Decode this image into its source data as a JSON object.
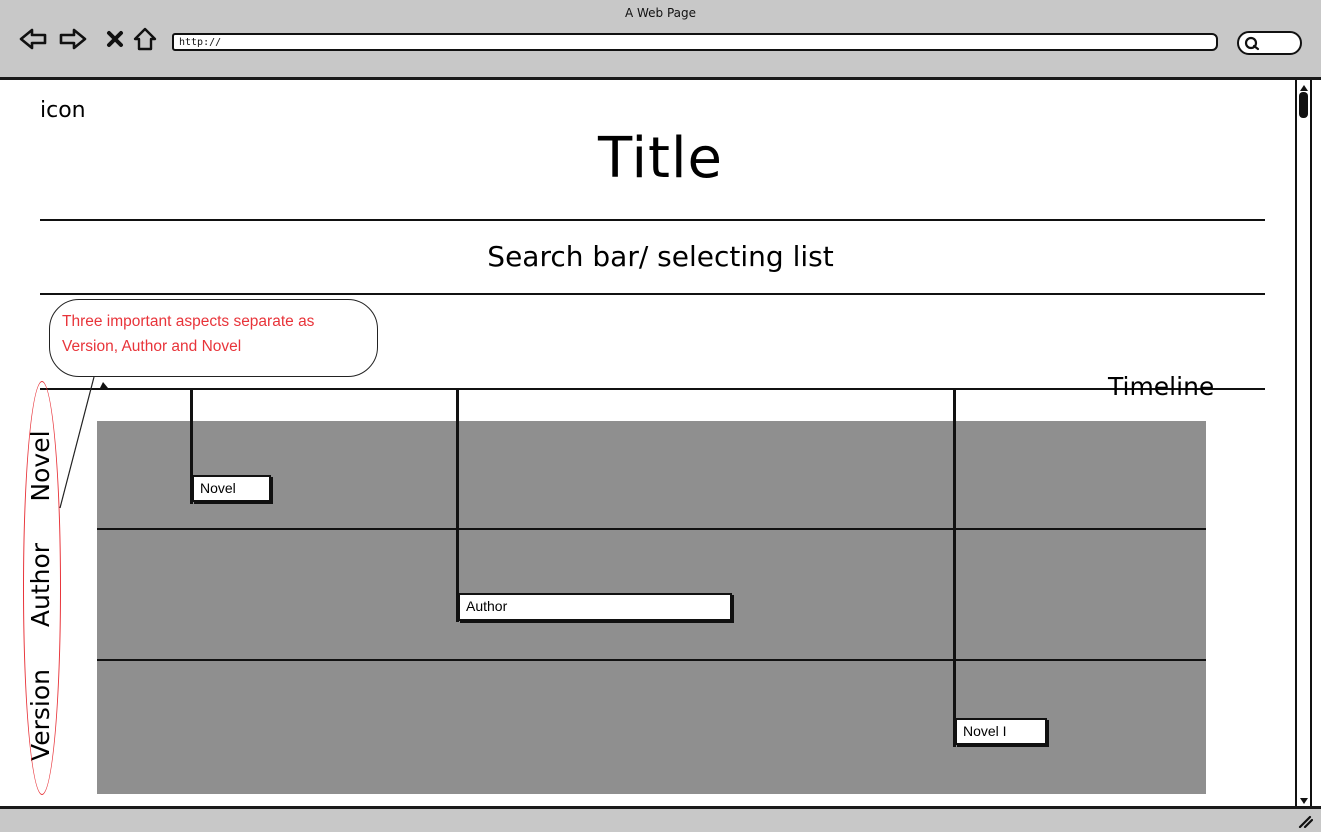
{
  "window": {
    "title": "A Web Page"
  },
  "toolbar": {
    "icons": [
      "back-arrow-icon",
      "forward-arrow-icon",
      "close-icon",
      "home-icon",
      "search-icon"
    ],
    "url_value": "http://"
  },
  "page": {
    "icon_placeholder": "icon",
    "title": "Title",
    "search_label": "Search bar/ selecting list",
    "callout_text": "Three important aspects separate as Version, Author and Novel",
    "timeline_label": "Timeline",
    "lanes": [
      "Novel",
      "Author",
      "Version"
    ],
    "tags": {
      "novel": "Novel",
      "author": "Author",
      "novel_i": "Novel I"
    }
  },
  "colors": {
    "chrome": "#c8c8c8",
    "timeline_panel": "#8f8f8f",
    "annotation_red": "#e8343a"
  }
}
